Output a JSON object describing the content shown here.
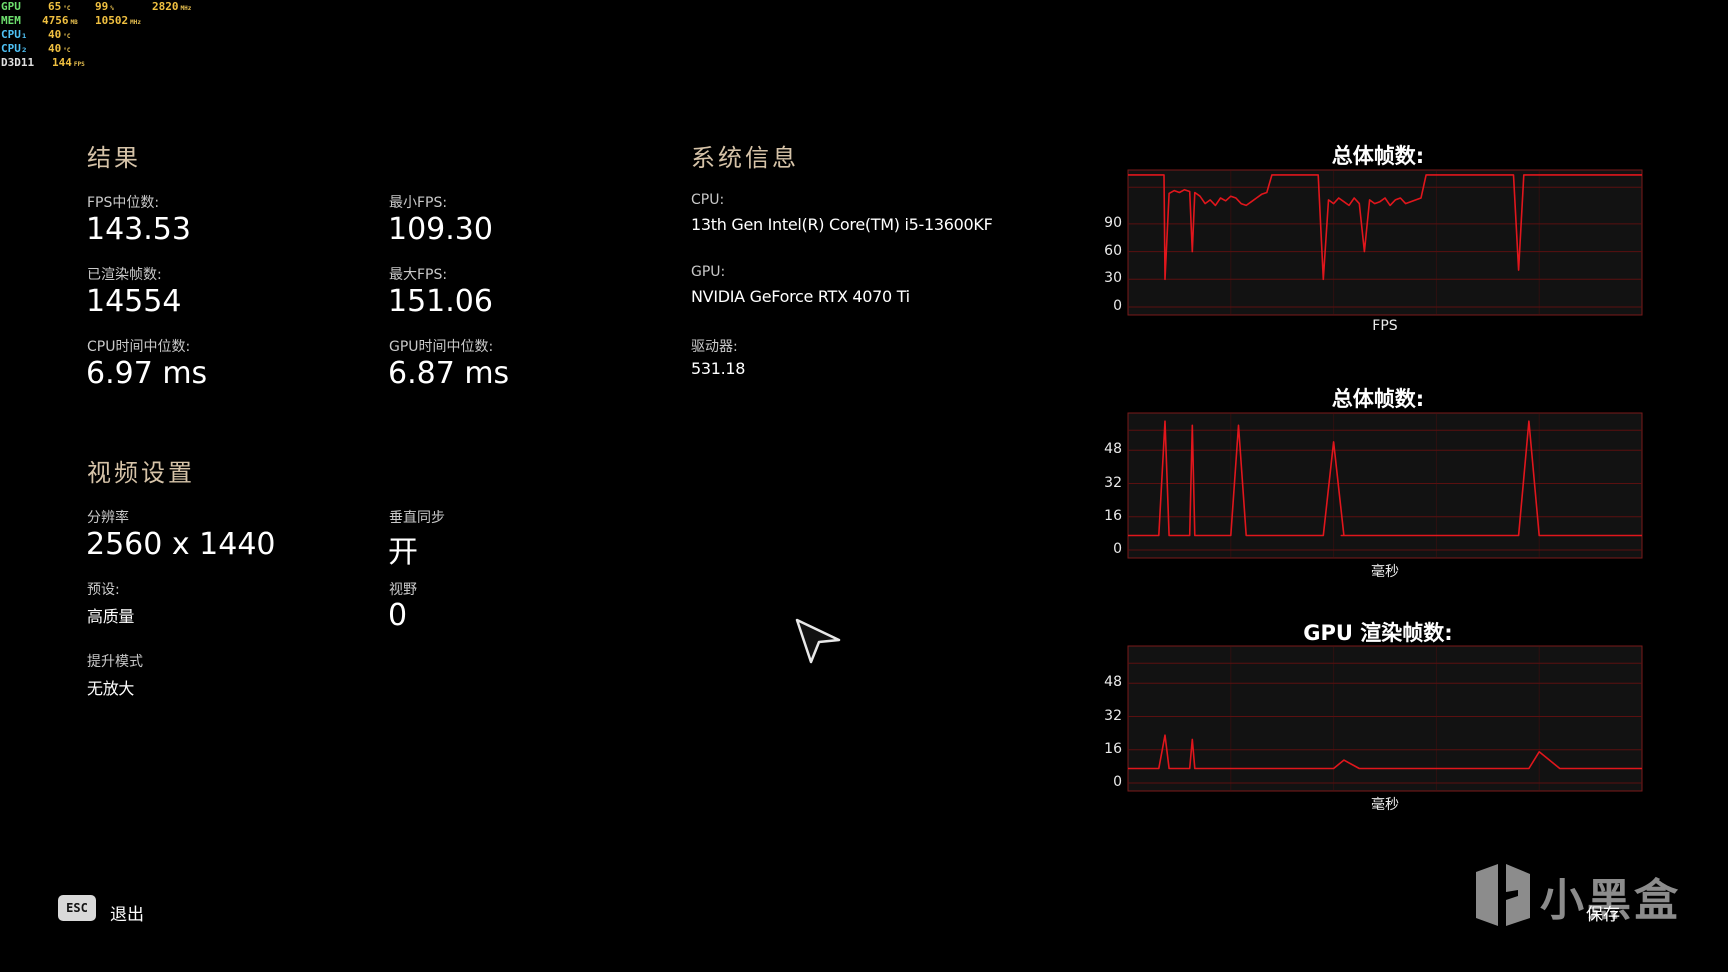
{
  "osd": {
    "rows": [
      {
        "label": "GPU",
        "label_color": "#6ee06e",
        "cells": [
          {
            "v": "65",
            "u": "°C"
          },
          {
            "v": "99",
            "u": "%"
          },
          {
            "v": "2820",
            "u": "MHz"
          }
        ]
      },
      {
        "label": "MEM",
        "label_color": "#6ee06e",
        "cells": [
          {
            "v": "4756",
            "u": "MB"
          },
          {
            "v": "10502",
            "u": "MHz"
          }
        ]
      },
      {
        "label": "CPU₁",
        "label_color": "#4fc3f7",
        "cells": [
          {
            "v": "40",
            "u": "°C"
          }
        ]
      },
      {
        "label": "CPU₂",
        "label_color": "#4fc3f7",
        "cells": [
          {
            "v": "40",
            "u": "°C"
          }
        ]
      },
      {
        "label": "D3D11",
        "label_color": "#e0e0e0",
        "cells": [
          {
            "v": "144",
            "u": "FPS"
          }
        ]
      }
    ],
    "value_color": "#f0c040"
  },
  "results": {
    "title": "结果",
    "fps_median_label": "FPS中位数:",
    "fps_median": "143.53",
    "fps_min_label": "最小FPS:",
    "fps_min": "109.30",
    "frames_rendered_label": "已渲染帧数:",
    "frames_rendered": "14554",
    "fps_max_label": "最大FPS:",
    "fps_max": "151.06",
    "cpu_time_label": "CPU时间中位数:",
    "cpu_time": "6.97 ms",
    "gpu_time_label": "GPU时间中位数:",
    "gpu_time": "6.87 ms"
  },
  "system": {
    "title": "系统信息",
    "cpu_label": "CPU:",
    "cpu": "13th Gen Intel(R) Core(TM) i5-13600KF",
    "gpu_label": "GPU:",
    "gpu": "NVIDIA GeForce RTX 4070 Ti",
    "driver_label": "驱动器:",
    "driver": "531.18"
  },
  "video": {
    "title": "视频设置",
    "resolution_label": "分辨率",
    "resolution": "2560 x 1440",
    "vsync_label": "垂直同步",
    "vsync": "开",
    "preset_label": "预设:",
    "preset": "高质量",
    "fov_label": "视野",
    "fov": "0",
    "upscale_label": "提升模式",
    "upscale": "无放大"
  },
  "footer": {
    "esc_key": "ESC",
    "exit_label": "退出",
    "save_label": "保存",
    "watermark": "小黑盒"
  },
  "colors": {
    "line": "#e0161c",
    "plot_bg": "#121212",
    "grid": "#5a1010",
    "border": "#7a1a1a"
  },
  "chart_data": [
    {
      "type": "line",
      "title": "总体帧数:",
      "xlabel": "FPS",
      "ylabel": "",
      "ylim": [
        0,
        144
      ],
      "yticks": [
        0,
        30,
        60,
        90
      ],
      "x": [
        0,
        10,
        20,
        30,
        40,
        50,
        60,
        70,
        72,
        80,
        90,
        100,
        110,
        120,
        125,
        130,
        140,
        150,
        160,
        170,
        180,
        190,
        200,
        210,
        220,
        230,
        240,
        250,
        260,
        270,
        280,
        290,
        300,
        310,
        320,
        330,
        340,
        350,
        360,
        370,
        380,
        390,
        400,
        410,
        420,
        430,
        440,
        450,
        460,
        470,
        480,
        490,
        500,
        510,
        520,
        530,
        540,
        550,
        560,
        570,
        580,
        590,
        600,
        610,
        620,
        630,
        640,
        650,
        660,
        670,
        680,
        690,
        700,
        710,
        720,
        730,
        740,
        750,
        760,
        770,
        780,
        790,
        800,
        810,
        820,
        830,
        840,
        850,
        860,
        870,
        880,
        890,
        900,
        910,
        920,
        930,
        940,
        950,
        960,
        970,
        980,
        990,
        1000
      ],
      "values": [
        143,
        143,
        143,
        143,
        143,
        143,
        143,
        143,
        30,
        123,
        126,
        124,
        127,
        125,
        60,
        124,
        120,
        112,
        116,
        110,
        118,
        115,
        120,
        118,
        112,
        110,
        114,
        118,
        122,
        124,
        143,
        143,
        143,
        143,
        143,
        143,
        143,
        143,
        143,
        143,
        30,
        116,
        112,
        118,
        114,
        110,
        118,
        112,
        60,
        116,
        112,
        114,
        118,
        110,
        116,
        118,
        112,
        114,
        116,
        118,
        143,
        143,
        143,
        143,
        143,
        143,
        143,
        143,
        143,
        143,
        143,
        143,
        143,
        143,
        143,
        143,
        143,
        143,
        40,
        143,
        143,
        143,
        143,
        143,
        143,
        143,
        143,
        143,
        143,
        143,
        143,
        143,
        143,
        143,
        143,
        143,
        143,
        143,
        143,
        143,
        143,
        143,
        143
      ]
    },
    {
      "type": "line",
      "title": "总体帧数:",
      "xlabel": "毫秒",
      "ylabel": "",
      "ylim": [
        0,
        64
      ],
      "yticks": [
        0,
        16,
        32,
        48
      ],
      "x": [
        0,
        20,
        40,
        60,
        72,
        80,
        100,
        120,
        125,
        130,
        160,
        180,
        200,
        215,
        230,
        260,
        300,
        350,
        380,
        400,
        420,
        415,
        450,
        470,
        500,
        520,
        560,
        600,
        660,
        700,
        740,
        760,
        780,
        800,
        840,
        880,
        900,
        920,
        940,
        960,
        980,
        1000
      ],
      "values": [
        7,
        7,
        7,
        7,
        62,
        7,
        7,
        7,
        60,
        7,
        7,
        7,
        7,
        60,
        7,
        7,
        7,
        7,
        7,
        52,
        7,
        7,
        7,
        7,
        7,
        7,
        7,
        7,
        7,
        7,
        7,
        7,
        62,
        7,
        7,
        7,
        7,
        7,
        7,
        7,
        7,
        7
      ]
    },
    {
      "type": "line",
      "title": "GPU 渲染帧数:",
      "xlabel": "毫秒",
      "ylabel": "",
      "ylim": [
        0,
        64
      ],
      "yticks": [
        0,
        16,
        32,
        48
      ],
      "x": [
        0,
        20,
        40,
        60,
        72,
        80,
        100,
        120,
        125,
        130,
        160,
        200,
        260,
        300,
        400,
        420,
        450,
        500,
        560,
        600,
        700,
        780,
        800,
        840,
        900,
        960,
        1000
      ],
      "values": [
        7,
        7,
        7,
        7,
        23,
        7,
        7,
        7,
        21,
        7,
        7,
        7,
        7,
        7,
        7,
        11,
        7,
        7,
        7,
        7,
        7,
        7,
        15,
        7,
        7,
        7,
        7
      ]
    }
  ]
}
